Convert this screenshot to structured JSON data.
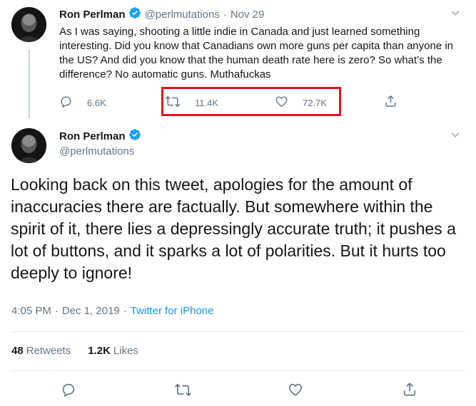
{
  "parent_tweet": {
    "display_name": "Ron Perlman",
    "handle": "@perlmutations",
    "separator": "·",
    "date": "Nov 29",
    "text": "As I was saying, shooting a little indie in Canada and just learned something interesting. Did you know that Canadians own more guns per capita than anyone in the US? And did you know that the human death rate here is zero? So what’s the difference? No automatic guns. Muthafuckas",
    "reply_count": "6.6K",
    "retweet_count": "11.4K",
    "like_count": "72.7K"
  },
  "main_tweet": {
    "display_name": "Ron Perlman",
    "handle": "@perlmutations",
    "text": "Looking back on this tweet, apologies for the amount of inaccuracies there are factually. But somewhere within the spirit of it, there lies a depressingly accurate truth; it pushes a lot of buttons, and it sparks a lot of polarities. But it hurts too deeply to ignore!",
    "time": "4:05 PM",
    "date": "Dec 1, 2019",
    "separator": "·",
    "source": "Twitter for iPhone",
    "retweets_count": "48",
    "retweets_label": "Retweets",
    "likes_count": "1.2K",
    "likes_label": "Likes"
  },
  "colors": {
    "text": "#14171a",
    "muted": "#657786",
    "link": "#1b95e0",
    "verified": "#1da1f2",
    "highlight_box": "#e0141e"
  },
  "icons": [
    "verified-badge-icon",
    "caret-down-icon",
    "reply-icon",
    "retweet-icon",
    "like-icon",
    "share-icon"
  ]
}
